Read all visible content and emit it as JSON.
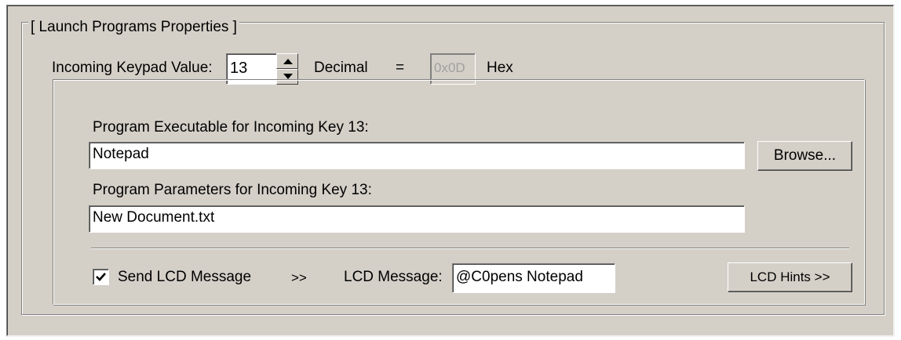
{
  "group": {
    "legend": "[ Launch Programs Properties ]"
  },
  "keypad": {
    "label": "Incoming Keypad Value:",
    "value": "13",
    "unit": "Decimal",
    "equals": "=",
    "hex_value": "0x0D",
    "hex_unit": "Hex"
  },
  "program": {
    "exec_label": "Program Executable for Incoming Key 13:",
    "exec_value": "Notepad",
    "browse_label": "Browse...",
    "params_label": "Program Parameters for Incoming Key 13:",
    "params_value": "New Document.txt"
  },
  "lcd": {
    "checkbox_label": "Send LCD Message",
    "checked": true,
    "arrows": ">>",
    "message_label": "LCD Message:",
    "message_value": "@C0pens Notepad",
    "hints_label": "LCD Hints >>"
  },
  "icons": {
    "spinner_up": "spin-up-icon",
    "spinner_down": "spin-down-icon",
    "check": "checkmark-icon"
  }
}
